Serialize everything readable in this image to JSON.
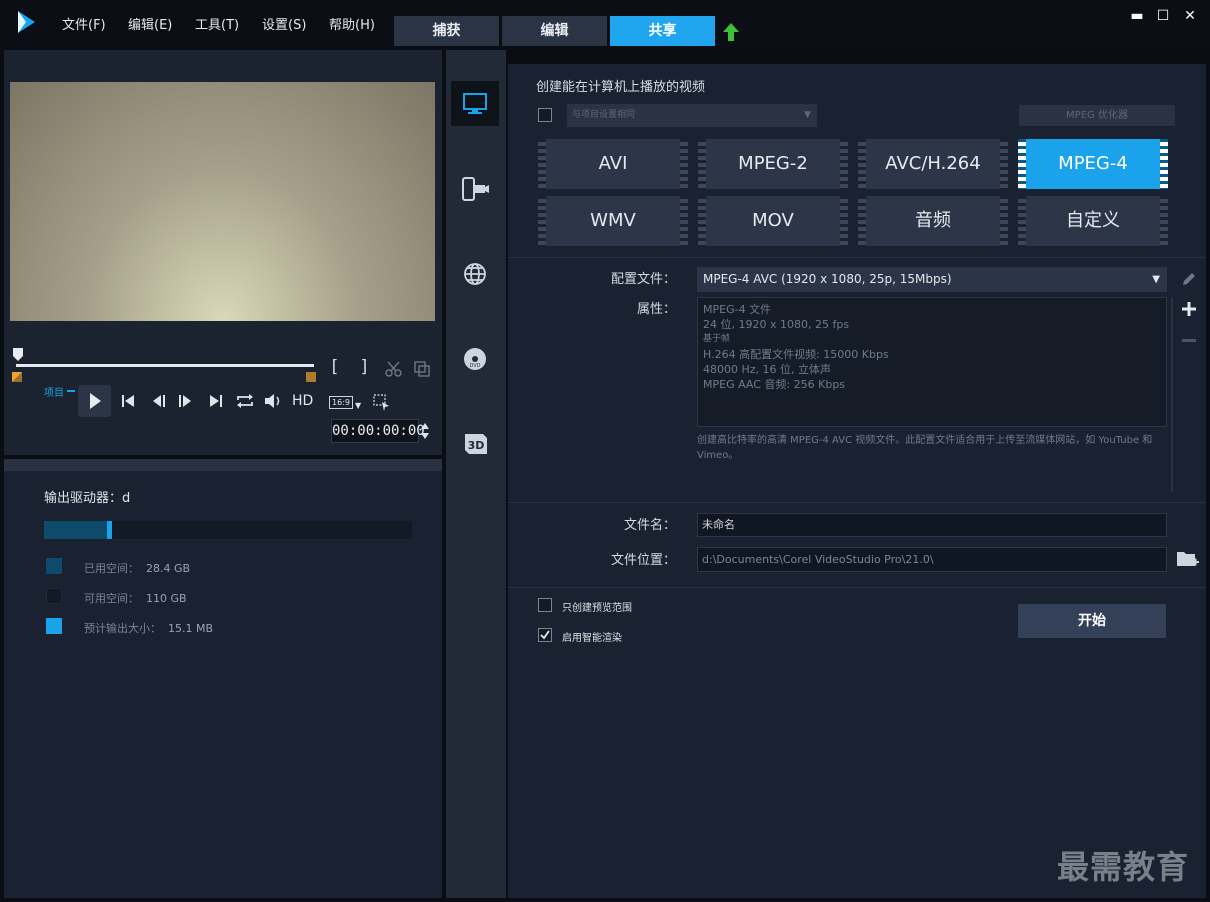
{
  "menubar": {
    "items": [
      "文件(F)",
      "编辑(E)",
      "工具(T)",
      "设置(S)",
      "帮助(H)"
    ],
    "tabs": [
      "捕获",
      "编辑",
      "共享"
    ],
    "active_tab": "共享"
  },
  "window_controls": {
    "minimize": "▬",
    "maximize": "☐",
    "close": "✕"
  },
  "player": {
    "project_label": "项目",
    "hd_label": "HD",
    "aspect_label": "16:9",
    "timecode": "00:00:00:00",
    "mark_in": "[",
    "mark_out": "]"
  },
  "output_drive": {
    "title": "输出驱动器：d",
    "used_fraction": 0.17,
    "estimated_fraction": 0.01,
    "legend": [
      {
        "label": "已用空间：",
        "value": "28.4 GB",
        "color": "#0d4a6b"
      },
      {
        "label": "可用空间：",
        "value": "110 GB",
        "color": "#131a26"
      },
      {
        "label": "预计输出大小：",
        "value": "15.1 MB",
        "color": "#1aa2ea"
      }
    ]
  },
  "share": {
    "heading": "创建能在计算机上播放的视频",
    "match_project_label": "与项目设置相同",
    "mpeg_optimizer_label": "MPEG 优化器",
    "formats_row1": [
      "AVI",
      "MPEG-2",
      "AVC/H.264",
      "MPEG-4"
    ],
    "formats_row2": [
      "WMV",
      "MOV",
      "音频",
      "自定义"
    ],
    "active_format": "MPEG-4",
    "profile_label": "配置文件：",
    "profile_value": "MPEG-4 AVC (1920 x 1080, 25p, 15Mbps)",
    "properties_label": "属性：",
    "properties_lines": [
      "MPEG-4 文件",
      "24 位, 1920 x 1080, 25 fps",
      "基于帧",
      "H.264 高配置文件视频: 15000 Kbps",
      "48000 Hz, 16 位, 立体声",
      "MPEG AAC 音频: 256 Kbps"
    ],
    "description": "创建高比特率的高清 MPEG-4 AVC 视频文件。此配置文件适合用于上传至流媒体网站，如 YouTube 和 Vimeo。",
    "filename_label": "文件名：",
    "filename_value": "未命名",
    "location_label": "文件位置：",
    "location_value": "d:\\Documents\\Corel VideoStudio Pro\\21.0\\",
    "preview_only_label": "只创建预览范围",
    "smart_render_label": "启用智能渲染",
    "preview_only_checked": false,
    "smart_render_checked": true,
    "start_button": "开始"
  },
  "watermark": "最需教育",
  "colors": {
    "accent": "#1aa2ea",
    "upload_arrow": "#3fbf3a"
  }
}
